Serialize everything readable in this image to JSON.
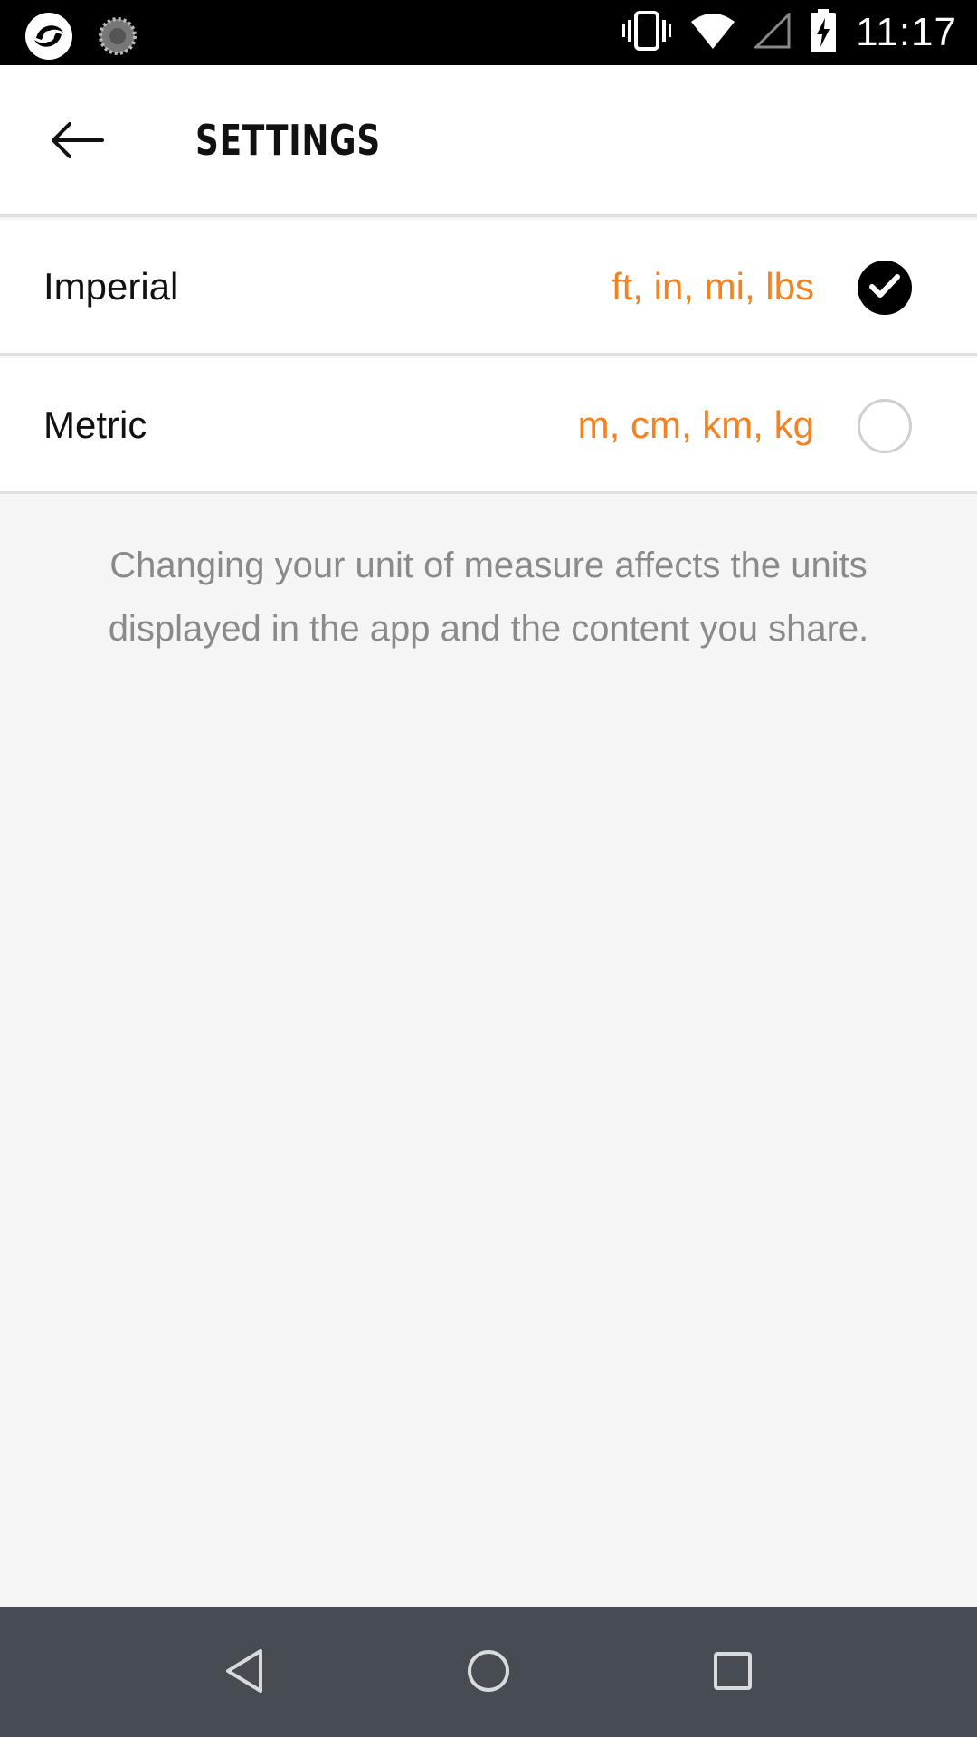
{
  "status_bar": {
    "time": "11:17",
    "left_icons": [
      "app-logo-icon",
      "loading-spinner-icon"
    ],
    "right_icons": [
      "vibrate-icon",
      "wifi-icon",
      "cell-signal-icon",
      "battery-charging-icon"
    ]
  },
  "header": {
    "title": "SETTINGS",
    "back_icon": "arrow-left-icon"
  },
  "options": [
    {
      "label": "Imperial",
      "units": "ft, in, mi, lbs",
      "selected": true
    },
    {
      "label": "Metric",
      "units": "m, cm, km, kg",
      "selected": false
    }
  ],
  "help_text": "Changing your unit of measure affects the units displayed in the app and the content you share.",
  "colors": {
    "accent_orange": "#f58220",
    "nav_bar": "#464c52",
    "background": "#f5f5f5"
  },
  "nav_bar": {
    "icons": [
      "nav-back-icon",
      "nav-home-icon",
      "nav-recents-icon"
    ]
  }
}
